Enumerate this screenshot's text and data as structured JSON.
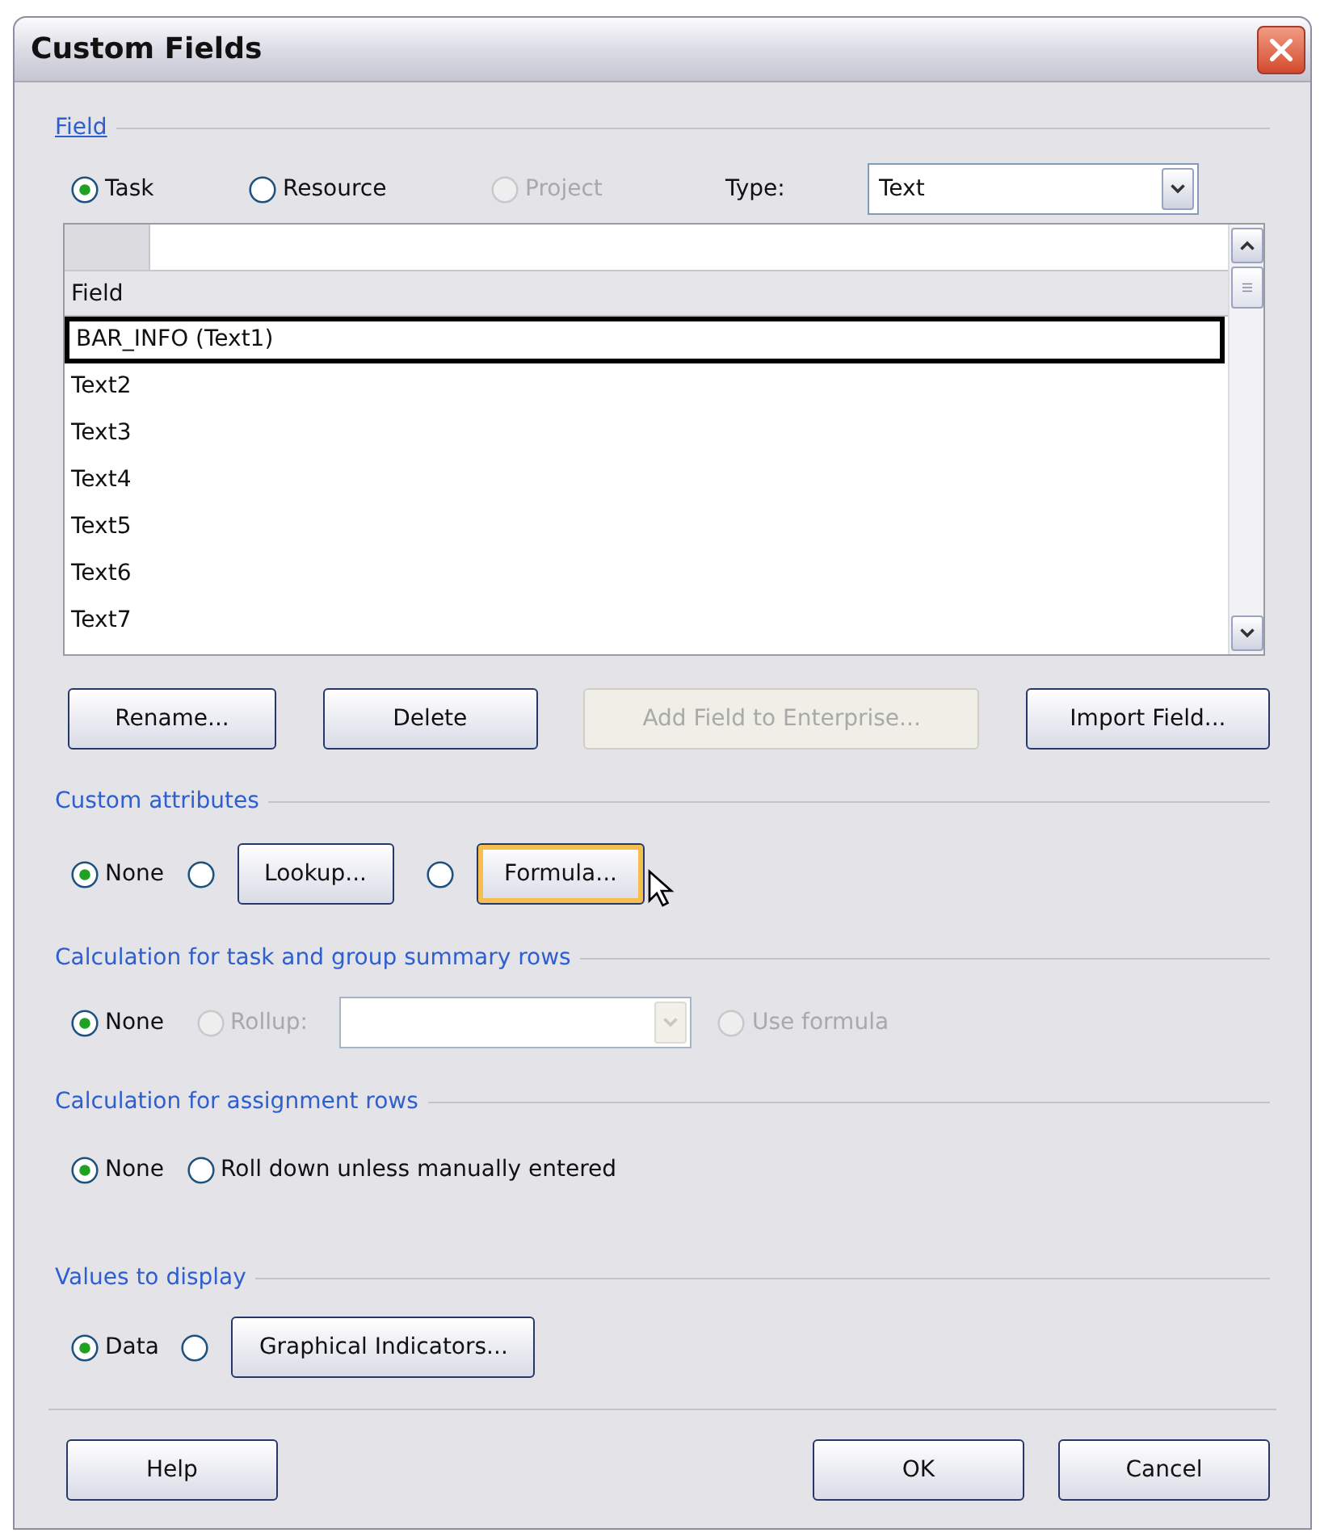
{
  "window": {
    "title": "Custom Fields"
  },
  "field_group": {
    "label": "Field",
    "scope_options": [
      {
        "label": "Task",
        "selected": true,
        "disabled": false
      },
      {
        "label": "Resource",
        "selected": false,
        "disabled": false
      },
      {
        "label": "Project",
        "selected": false,
        "disabled": true
      }
    ],
    "type_label": "Type:",
    "type_dropdown": {
      "value": "Text"
    },
    "grid": {
      "column_header": "Field",
      "rows": [
        {
          "text": "BAR_INFO (Text1)",
          "selected": true
        },
        {
          "text": "Text2",
          "selected": false
        },
        {
          "text": "Text3",
          "selected": false
        },
        {
          "text": "Text4",
          "selected": false
        },
        {
          "text": "Text5",
          "selected": false
        },
        {
          "text": "Text6",
          "selected": false
        },
        {
          "text": "Text7",
          "selected": false
        }
      ]
    },
    "buttons": [
      {
        "label": "Rename...",
        "disabled": false
      },
      {
        "label": "Delete",
        "disabled": false
      },
      {
        "label": "Add Field to Enterprise...",
        "disabled": true
      },
      {
        "label": "Import Field...",
        "disabled": false
      }
    ]
  },
  "custom_attributes": {
    "label": "Custom attributes",
    "options": [
      {
        "label": "None",
        "selected": true
      },
      {
        "selected": false,
        "button": "Lookup...",
        "hovered": false
      },
      {
        "selected": false,
        "button": "Formula...",
        "hovered": true
      }
    ]
  },
  "calc_summary": {
    "label": "Calculation for task and group summary rows",
    "options": [
      {
        "kind": "radio",
        "label": "None",
        "selected": true,
        "disabled": false
      },
      {
        "kind": "radio_dropdown",
        "label": "Rollup:",
        "selected": false,
        "disabled": true
      },
      {
        "kind": "radio",
        "label": "Use formula",
        "selected": false,
        "disabled": true
      }
    ]
  },
  "calc_assignment": {
    "label": "Calculation for assignment rows",
    "options": [
      {
        "label": "None",
        "selected": true
      },
      {
        "label": "Roll down unless manually entered",
        "selected": false
      }
    ]
  },
  "values_to_display": {
    "label": "Values to display",
    "options": [
      {
        "label": "Data",
        "selected": true
      },
      {
        "selected": false,
        "button": "Graphical Indicators...",
        "hovered": false
      }
    ]
  },
  "footer_buttons": [
    {
      "label": "Help"
    },
    {
      "label": "OK"
    },
    {
      "label": "Cancel"
    }
  ]
}
